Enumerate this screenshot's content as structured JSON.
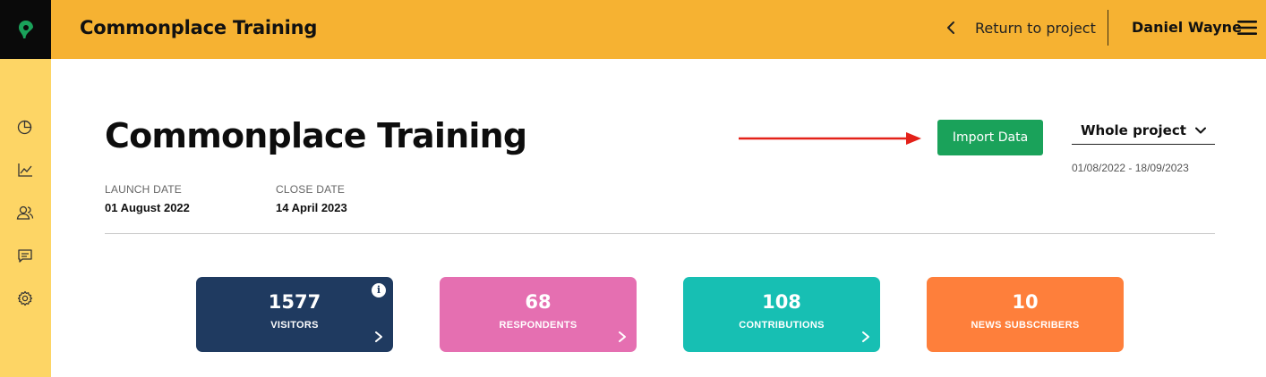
{
  "header": {
    "app_title": "Commonplace Training",
    "return_label": "Return to project",
    "user_name": "Daniel Wayne",
    "brand_color": "#f6b232"
  },
  "sidebar": {
    "items": [
      {
        "name": "pie-chart-icon"
      },
      {
        "name": "line-chart-icon"
      },
      {
        "name": "people-icon"
      },
      {
        "name": "comments-icon"
      },
      {
        "name": "settings-gear-icon"
      }
    ],
    "color": "#fdd565"
  },
  "project": {
    "title": "Commonplace Training",
    "launch_label": "LAUNCH DATE",
    "launch_value": "01 August 2022",
    "close_label": "CLOSE DATE",
    "close_value": "14 April 2023"
  },
  "actions": {
    "import_label": "Import Data",
    "import_color": "#1aa25a",
    "period_selected": "Whole project",
    "date_range": "01/08/2022 - 18/09/2023"
  },
  "stats": [
    {
      "value": "1577",
      "label": "VISITORS",
      "color": "#1f3a60",
      "info": "i"
    },
    {
      "value": "68",
      "label": "RESPONDENTS",
      "color": "#e56fb1"
    },
    {
      "value": "108",
      "label": "CONTRIBUTIONS",
      "color": "#17bfb3"
    },
    {
      "value": "10",
      "label": "NEWS SUBSCRIBERS",
      "color": "#fe7f3b"
    }
  ]
}
